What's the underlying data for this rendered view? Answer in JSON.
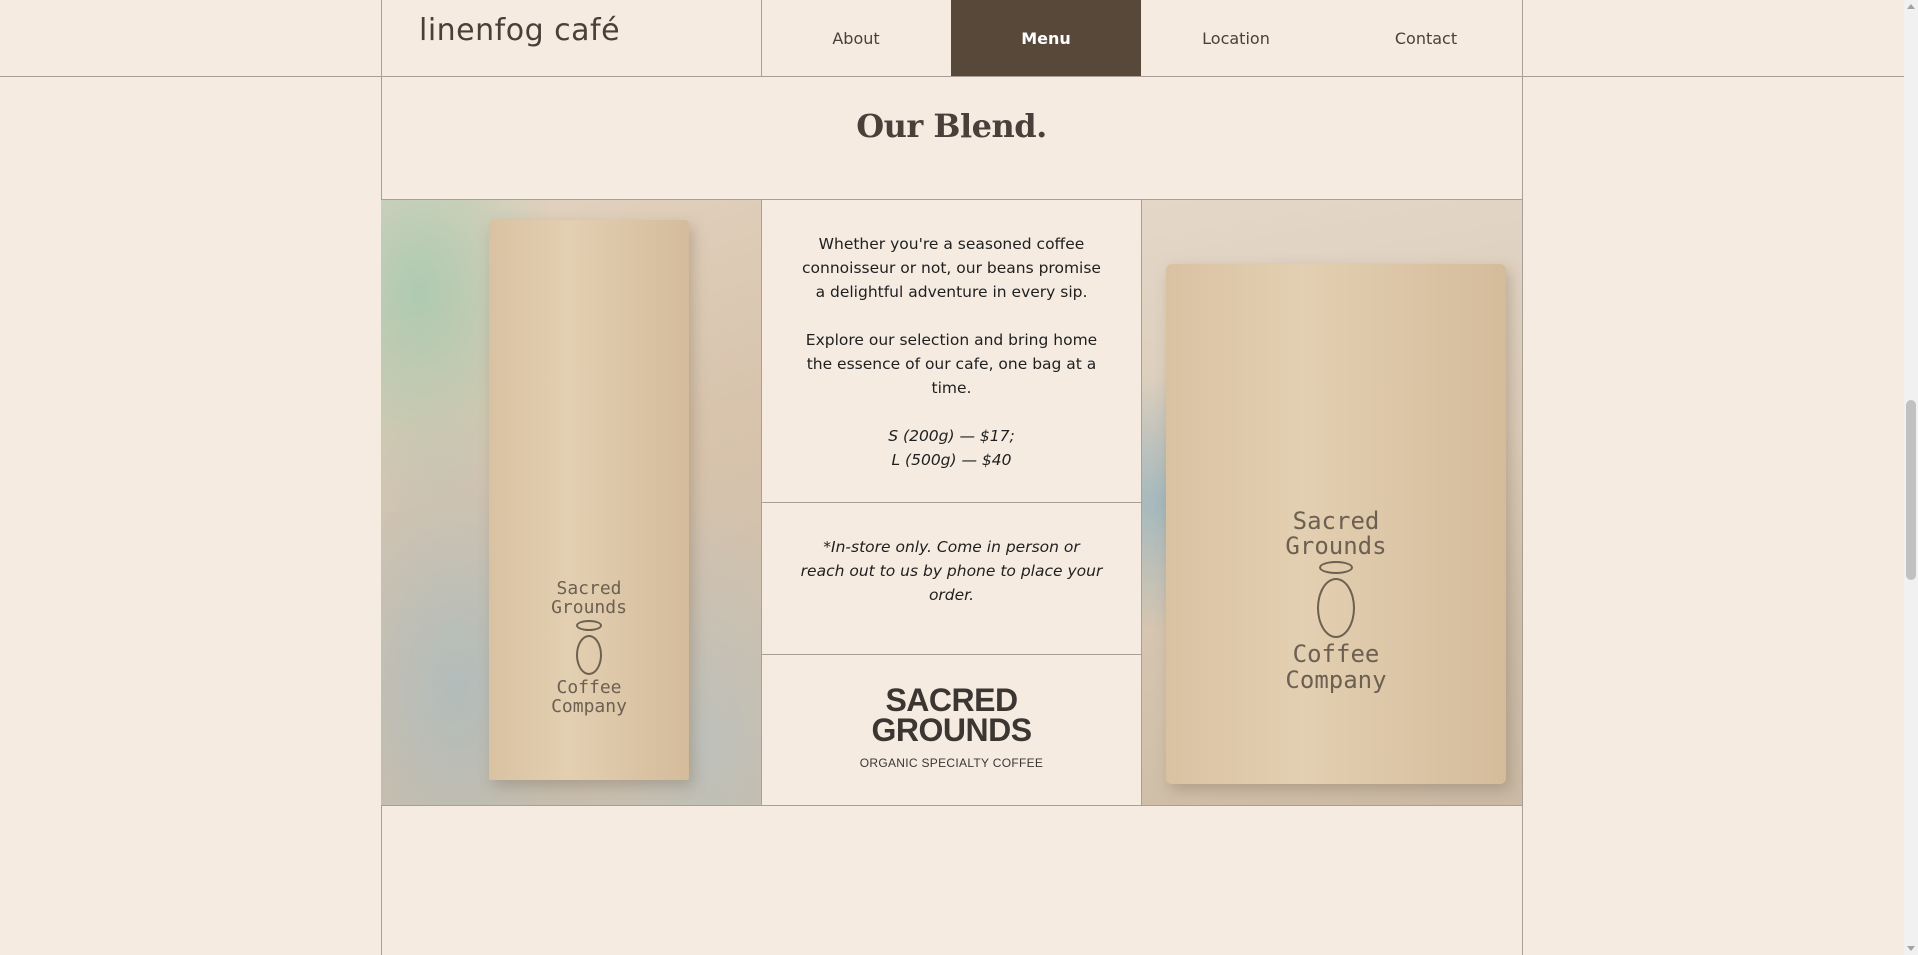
{
  "header": {
    "brand": "linenfog café",
    "nav": [
      {
        "label": "About",
        "active": false
      },
      {
        "label": "Menu",
        "active": true
      },
      {
        "label": "Location",
        "active": false
      },
      {
        "label": "Contact",
        "active": false
      }
    ]
  },
  "section": {
    "title": "Our Blend."
  },
  "description": {
    "paragraph_1": "Whether you're a seasoned coffee connoisseur or not, our beans promise a delightful adventure in every sip.",
    "paragraph_2": "Explore our selection and bring home the essence of our cafe, one bag at a time.",
    "price_small": "S (200g) — $17;",
    "price_large": "L (500g) — $40"
  },
  "note": {
    "text": "*In-store only. Come in person or reach out to us by phone to place your order."
  },
  "logo": {
    "line_1": "SACRED",
    "line_2": "GROUNDS",
    "tagline": "ORGANIC SPECIALTY COFFEE"
  },
  "bag_stamp": {
    "line_1": "Sacred",
    "line_2": "Grounds",
    "line_3": "Coffee",
    "line_4": "Company"
  },
  "colors": {
    "background": "#f5ebe1",
    "accent_nav_active": "#574839",
    "text_dark": "#4b4039",
    "rule": "#a99f97"
  }
}
